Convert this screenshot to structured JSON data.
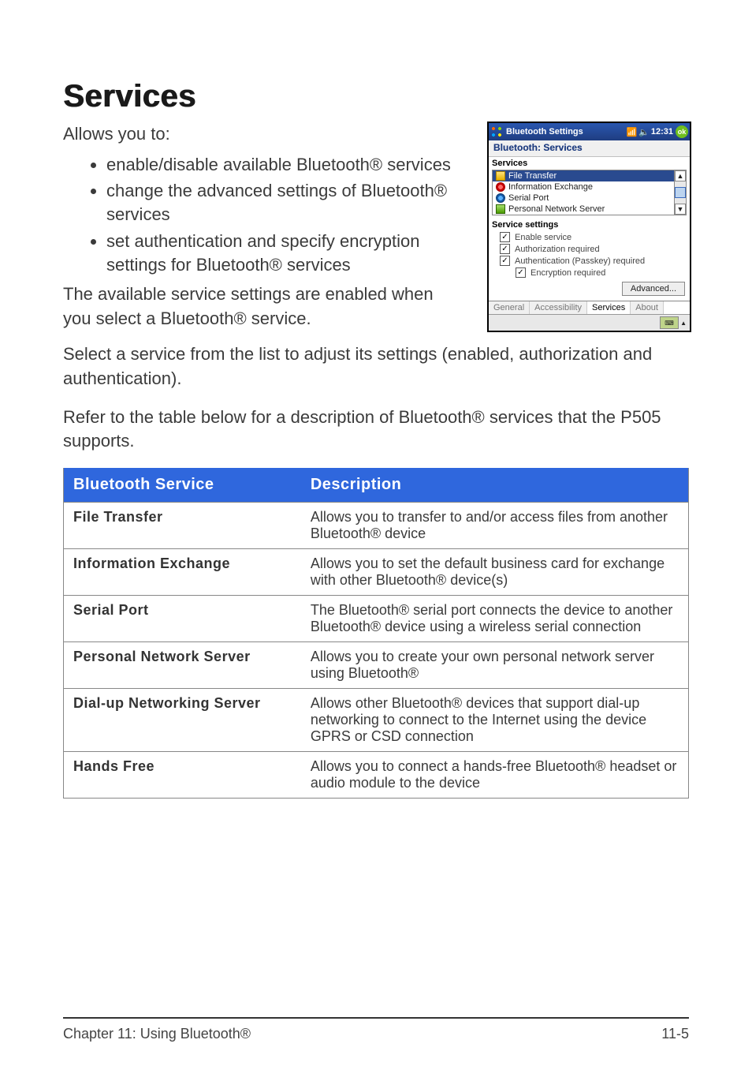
{
  "heading": "Services",
  "intro": "Allows you to:",
  "bullets": [
    "enable/disable available Bluetooth® services",
    "change the advanced settings of Bluetooth® services",
    "set authentication and specify encryption settings for Bluetooth® services"
  ],
  "para1": "The available service settings are enabled when you select a Bluetooth® service.",
  "para2": "Select a service from the list to adjust its settings (enabled, authorization and authentication).",
  "para3": "Refer to the table below for a description of Bluetooth® services that the P505 supports.",
  "ppc": {
    "title": "Bluetooth Settings",
    "time": "12:31",
    "ok": "ok",
    "subbar": "Bluetooth: Services",
    "services_label": "Services",
    "service_items": [
      {
        "label": "File Transfer",
        "icon": "folder",
        "selected": true
      },
      {
        "label": "Information Exchange",
        "icon": "info",
        "selected": false
      },
      {
        "label": "Serial Port",
        "icon": "serial",
        "selected": false
      },
      {
        "label": "Personal Network Server",
        "icon": "net",
        "selected": false
      }
    ],
    "settings_label": "Service settings",
    "checks": [
      {
        "label": "Enable service",
        "checked": true,
        "indent": false
      },
      {
        "label": "Authorization required",
        "checked": true,
        "indent": false
      },
      {
        "label": "Authentication (Passkey) required",
        "checked": true,
        "indent": false
      },
      {
        "label": "Encryption required",
        "checked": true,
        "indent": true
      }
    ],
    "advanced_btn": "Advanced...",
    "tabs": [
      "General",
      "Accessibility",
      "Services",
      "About"
    ],
    "active_tab_index": 2,
    "sip_arrow": "▲"
  },
  "table": {
    "headers": [
      "Bluetooth Service",
      "Description"
    ],
    "rows": [
      {
        "name": "File Transfer",
        "desc": "Allows you to transfer to and/or access files from another Bluetooth® device"
      },
      {
        "name": "Information Exchange",
        "desc": "Allows you to set the default business card for exchange with other Bluetooth® device(s)"
      },
      {
        "name": "Serial Port",
        "desc": "The Bluetooth® serial port connects the device to another Bluetooth® device using a wireless serial connection"
      },
      {
        "name": "Personal Network Server",
        "desc": "Allows you to create your own personal network server using Bluetooth®"
      },
      {
        "name": "Dial-up Networking Server",
        "desc": "Allows other Bluetooth® devices that support dial-up networking to connect to the Internet using the device GPRS or CSD connection"
      },
      {
        "name": "Hands Free",
        "desc": "Allows you to connect a hands-free Bluetooth® headset or audio module to the device"
      }
    ]
  },
  "footer": {
    "left": "Chapter 11: Using Bluetooth®",
    "right": "11-5"
  }
}
